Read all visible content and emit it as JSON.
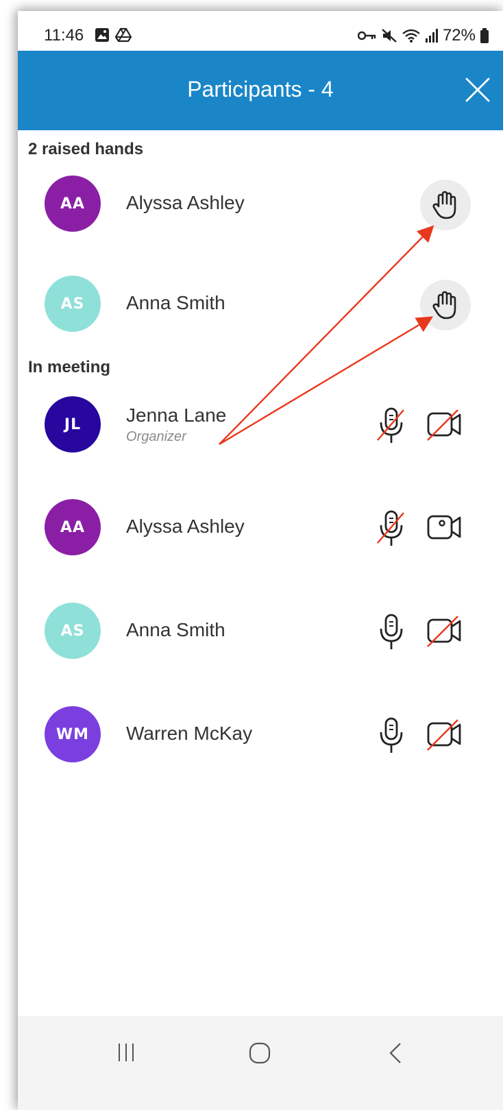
{
  "status_bar": {
    "time": "11:46",
    "battery": "72%",
    "icons": [
      "image-icon",
      "drive-icon",
      "key-icon",
      "mute-icon",
      "wifi-icon",
      "signal-icon",
      "battery-icon"
    ]
  },
  "header": {
    "title": "Participants - 4",
    "close_icon": "close-icon",
    "color": "#1a86c8"
  },
  "raised_hands": {
    "label": "2 raised hands",
    "participants": [
      {
        "initials": "AA",
        "name": "Alyssa Ashley",
        "avatar_color": "#8a1fa6",
        "icon": "raised-hand-icon"
      },
      {
        "initials": "AS",
        "name": "Anna Smith",
        "avatar_color": "#8fe0d8",
        "icon": "raised-hand-icon"
      }
    ]
  },
  "in_meeting": {
    "label": "In meeting",
    "participants": [
      {
        "initials": "JL",
        "name": "Jenna Lane",
        "role": "Organizer",
        "avatar_color": "#27079e",
        "mic": "muted",
        "camera": "off"
      },
      {
        "initials": "AA",
        "name": "Alyssa Ashley",
        "role": "",
        "avatar_color": "#8a1fa6",
        "mic": "muted",
        "camera": "on"
      },
      {
        "initials": "AS",
        "name": "Anna Smith",
        "role": "",
        "avatar_color": "#8fe0d8",
        "mic": "on",
        "camera": "off"
      },
      {
        "initials": "WM",
        "name": "Warren McKay",
        "role": "",
        "avatar_color": "#7b3fe0",
        "mic": "on",
        "camera": "off"
      }
    ]
  },
  "annotation_color": "#e8381c",
  "nav_bar": [
    "recents-icon",
    "home-icon",
    "back-icon"
  ]
}
